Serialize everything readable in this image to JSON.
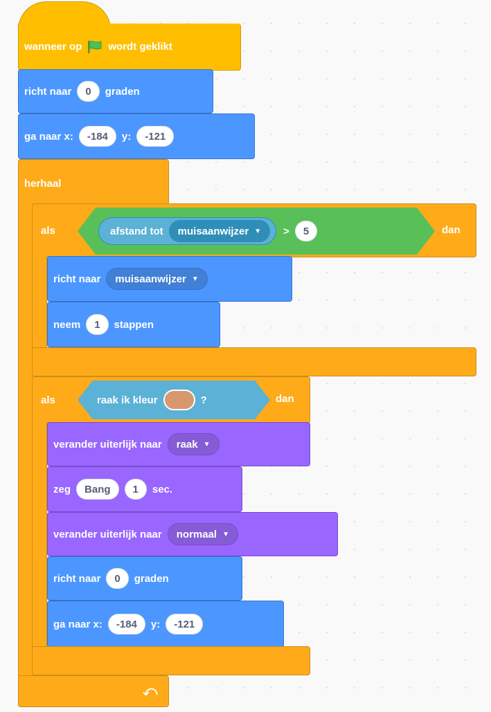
{
  "script": {
    "when_flag": {
      "before": "wanneer op",
      "after": "wordt geklikt",
      "flag_icon": "green-flag-icon",
      "flag_color": "#4cbf56"
    },
    "point_dir": {
      "label": "richt naar",
      "value": "0",
      "suffix": "graden"
    },
    "goto": {
      "label": "ga naar x:",
      "x": "-184",
      "y_label": "y:",
      "y": "-121"
    },
    "forever": {
      "label": "herhaal",
      "loop_icon": "loop-arrow-icon"
    },
    "if1": {
      "label": "als",
      "distance": {
        "label": "afstand tot",
        "target": "muisaanwijzer"
      },
      "operator": ">",
      "compare": "5",
      "then": "dan",
      "point_towards": {
        "label": "richt naar",
        "target": "muisaanwijzer"
      },
      "move": {
        "label": "neem",
        "value": "1",
        "suffix": "stappen"
      }
    },
    "if2": {
      "label": "als",
      "touching": {
        "label": "raak ik kleur",
        "color": "#d9976f",
        "suffix": "?"
      },
      "then": "dan",
      "costume1": {
        "label": "verander uiterlijk naar",
        "value": "raak"
      },
      "say": {
        "label": "zeg",
        "text": "Bang",
        "secs": "1",
        "suffix": "sec."
      },
      "costume2": {
        "label": "verander uiterlijk naar",
        "value": "normaal"
      },
      "point_dir": {
        "label": "richt naar",
        "value": "0",
        "suffix": "graden"
      },
      "goto": {
        "label": "ga naar x:",
        "x": "-184",
        "y_label": "y:",
        "y": "-121"
      }
    }
  },
  "colors": {
    "motion": "#4c97ff",
    "control": "#ffab19",
    "looks": "#9966ff",
    "events": "#ffbf00",
    "operators": "#59c059",
    "sensing": "#5cb1d6"
  }
}
